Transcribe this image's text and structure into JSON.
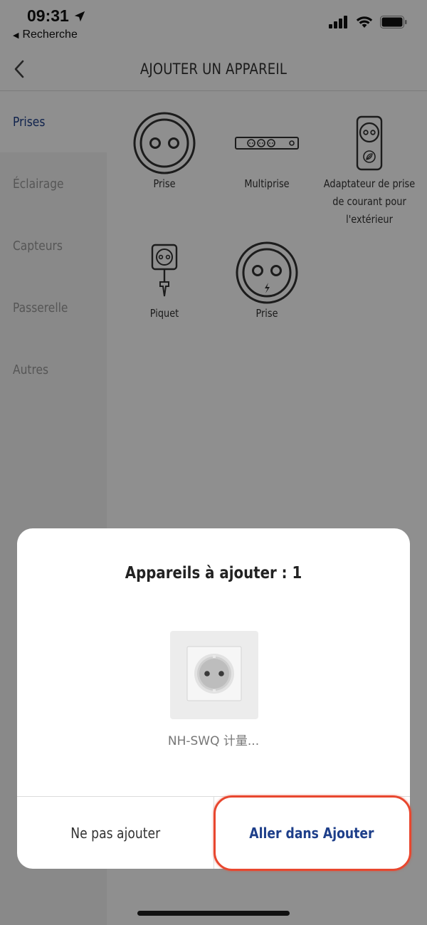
{
  "status_bar": {
    "time": "09:31",
    "back_app": "Recherche",
    "icons": [
      "location-arrow-icon",
      "signal-icon",
      "wifi-icon",
      "battery-icon"
    ]
  },
  "header": {
    "title": "AJOUTER UN APPAREIL",
    "back_icon": "chevron-left-icon"
  },
  "sidebar": {
    "items": [
      {
        "label": "Prises",
        "active": true
      },
      {
        "label": "Éclairage",
        "active": false
      },
      {
        "label": "Capteurs",
        "active": false
      },
      {
        "label": "Passerelle",
        "active": false
      },
      {
        "label": "Autres",
        "active": false
      }
    ]
  },
  "devices": [
    {
      "label": "Prise",
      "icon": "round-socket-icon"
    },
    {
      "label": "Multiprise",
      "icon": "power-strip-icon"
    },
    {
      "label": "Adaptateur de prise de courant pour l'extérieur",
      "icon": "outdoor-adapter-icon"
    },
    {
      "label": "Piquet",
      "icon": "garden-stake-icon"
    },
    {
      "label": "Prise",
      "icon": "metering-socket-icon"
    }
  ],
  "dialog": {
    "title": "Appareils à ajouter : 1",
    "device_name": "NH-SWQ 计量...",
    "cancel_label": "Ne pas ajouter",
    "confirm_label": "Aller dans Ajouter"
  },
  "colors": {
    "accent": "#1e3f8a",
    "highlight": "#e8472f",
    "overlay": "rgba(0,0,0,0.44)"
  }
}
